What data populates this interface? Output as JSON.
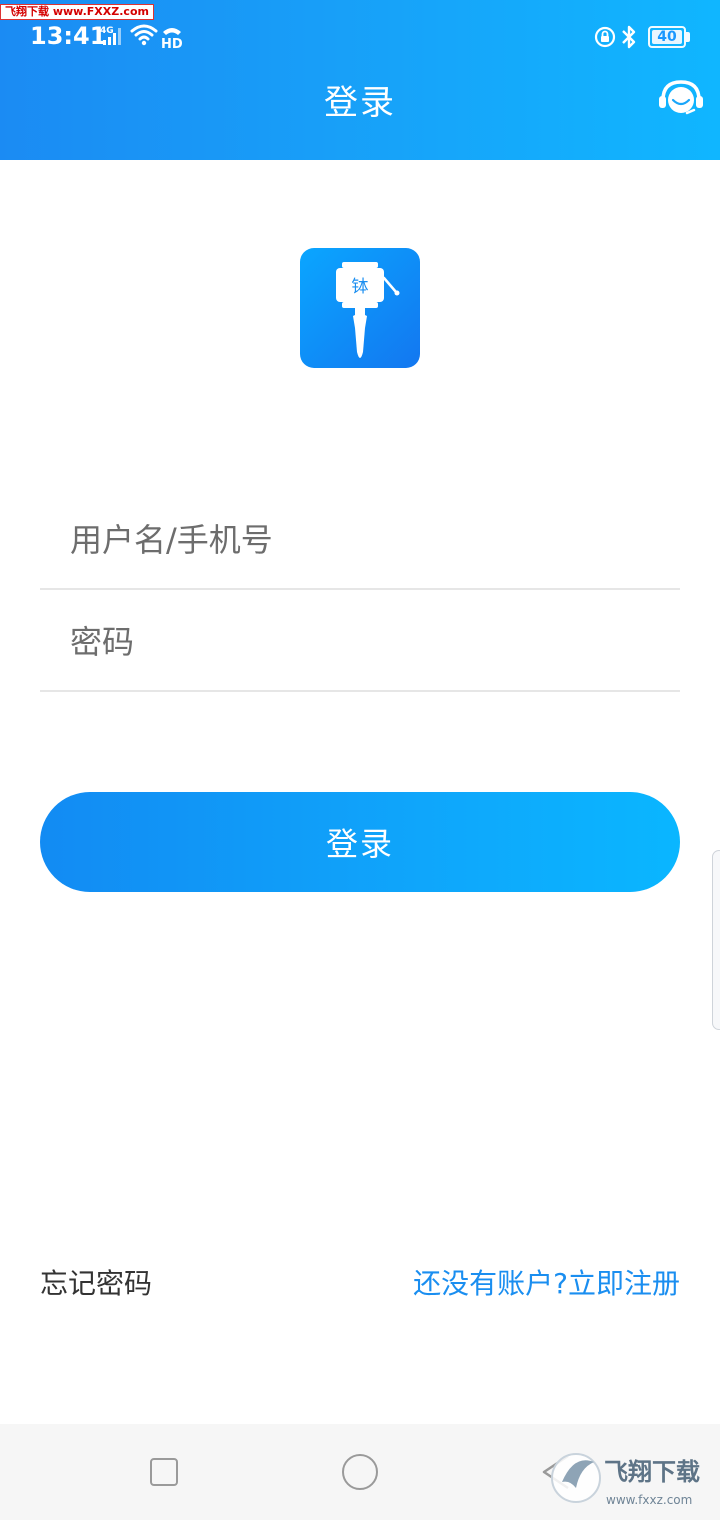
{
  "watermark_top": "飞翔下载 www.FXXZ.com",
  "status_bar": {
    "time": "13:41",
    "network": "4G",
    "hd": "HD",
    "battery": "40"
  },
  "header": {
    "title": "登录"
  },
  "logo": {
    "char": "钵"
  },
  "form": {
    "username_placeholder": "用户名/手机号",
    "password_placeholder": "密码",
    "username_value": "",
    "password_value": "",
    "login_label": "登录"
  },
  "links": {
    "forgot": "忘记密码",
    "register": "还没有账户?立即注册"
  },
  "watermark_bottom": {
    "brand": "飞翔下载",
    "url": "www.fxxz.com"
  },
  "colors": {
    "accent": "#1a8ef0",
    "header_start": "#1b8bf3",
    "header_end": "#10b6ff"
  }
}
